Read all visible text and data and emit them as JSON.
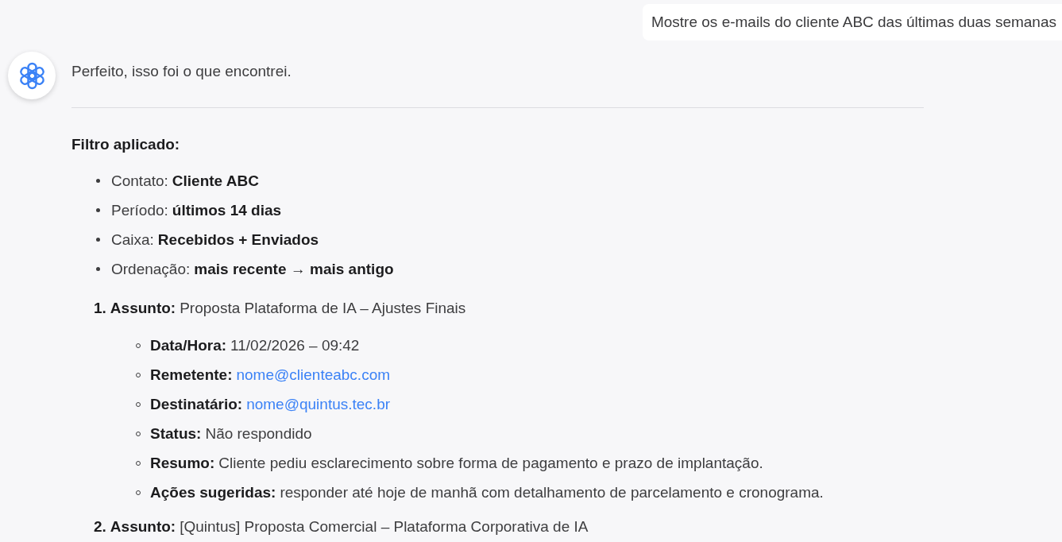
{
  "user_message": {
    "text": "Mostre os e-mails do cliente ABC das últimas duas semanas"
  },
  "assistant_message": {
    "intro": "Perfeito, isso foi o que encontrei.",
    "filter_heading": "Filtro aplicado:",
    "filters": [
      {
        "label": "Contato:",
        "value": "Cliente ABC"
      },
      {
        "label": "Período:",
        "value": "últimos 14 dias"
      },
      {
        "label": "Caixa:",
        "value": "Recebidos + Enviados"
      },
      {
        "label": "Ordenação:",
        "value": "mais recente → mais antigo"
      }
    ],
    "emails": [
      {
        "number": "1.",
        "subject_label": "Assunto:",
        "subject": "Proposta Plataforma de IA – Ajustes Finais",
        "details": [
          {
            "kind": "text",
            "label": "Data/Hora:",
            "value": "11/02/2026 – 09:42"
          },
          {
            "kind": "link",
            "label": "Remetente:",
            "value": "nome@clienteabc.com"
          },
          {
            "kind": "link",
            "label": "Destinatário:",
            "value": "nome@quintus.tec.br"
          },
          {
            "kind": "text",
            "label": "Status:",
            "value": "Não respondido"
          },
          {
            "kind": "text",
            "label": "Resumo:",
            "value": "Cliente pediu esclarecimento sobre forma de pagamento e prazo de implantação."
          },
          {
            "kind": "text",
            "label": "Ações sugeridas:",
            "value": "responder até hoje de manhã com detalhamento de parcelamento e cronograma."
          }
        ]
      },
      {
        "number": "2.",
        "subject_label": "Assunto:",
        "subject": "[Quintus] Proposta Comercial – Plataforma Corporativa de IA"
      }
    ]
  }
}
